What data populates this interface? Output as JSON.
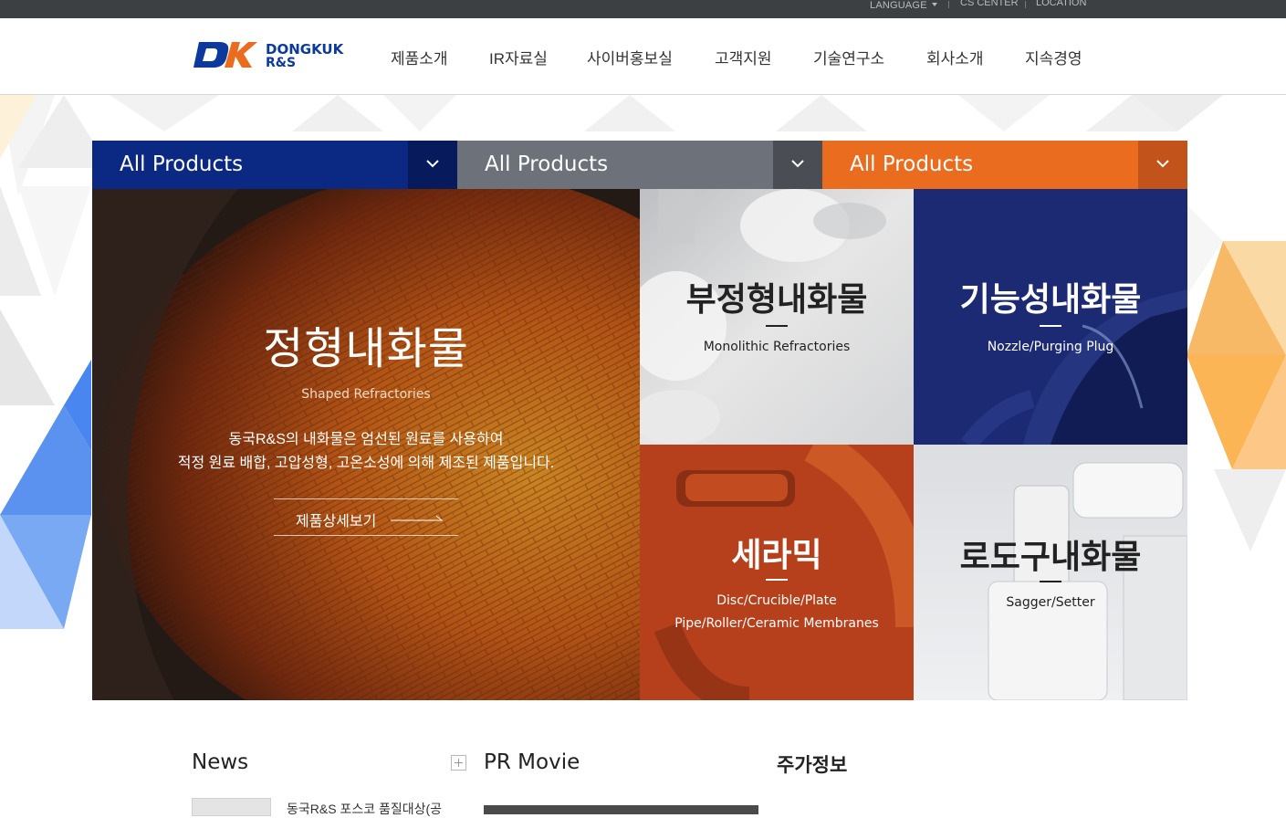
{
  "topbar": {
    "language": "LANGUAGE",
    "cs_center": "CS CENTER",
    "location": "LOCATION"
  },
  "logo": {
    "line1": "DONGKUK",
    "line2": "R&S"
  },
  "nav": [
    "제품소개",
    "IR자료실",
    "사이버홍보실",
    "고객지원",
    "기술연구소",
    "회사소개",
    "지속경영"
  ],
  "dropdowns": [
    {
      "label": "All Products",
      "color": "#0b2882"
    },
    {
      "label": "All Products",
      "color": "#6d7179"
    },
    {
      "label": "All Products",
      "color": "#ea6c1f"
    }
  ],
  "featured": {
    "title": "정형내화물",
    "subtitle": "Shaped Refractories",
    "desc_line1": "동국R&S의 내화물은 엄선된 원료를 사용하여",
    "desc_line2": "적정 원료 배합, 고압성형, 고온소성에 의해 제조된 제품입니다.",
    "more": "제품상세보기"
  },
  "tiles": [
    {
      "title": "부정형내화물",
      "sub1": "Monolithic Refractories",
      "sub2": ""
    },
    {
      "title": "기능성내화물",
      "sub1": "Nozzle/Purging Plug",
      "sub2": ""
    },
    {
      "title": "세라믹",
      "sub1": "Disc/Crucible/Plate",
      "sub2": "Pipe/Roller/Ceramic Membranes"
    },
    {
      "title": "로도구내화물",
      "sub1": "Sagger/Setter",
      "sub2": ""
    }
  ],
  "sections": {
    "news": "News",
    "news_item": "동국R&S 포스코 품질대상(공",
    "pr_movie": "PR Movie",
    "stock": "주가정보"
  }
}
